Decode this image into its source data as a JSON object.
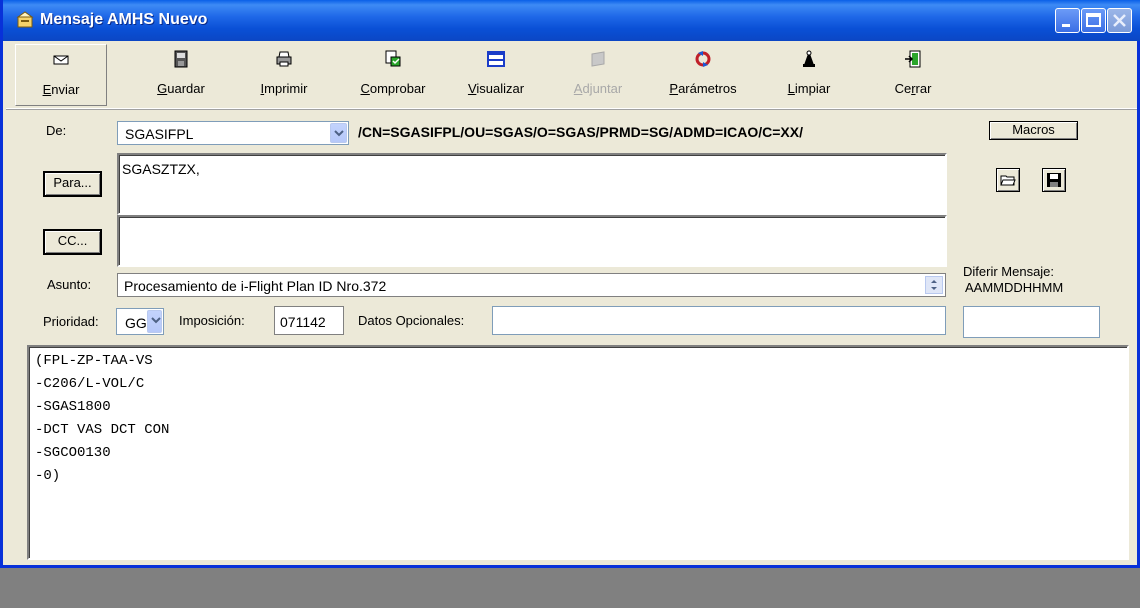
{
  "window": {
    "title": "Mensaje AMHS Nuevo"
  },
  "toolbar": {
    "items": [
      {
        "label": "Enviar",
        "accel": "E",
        "rest": "nviar",
        "icon": "send-icon",
        "enabled": true
      },
      {
        "label": "Guardar",
        "accel": "G",
        "rest": "uardar",
        "icon": "save-icon",
        "enabled": true
      },
      {
        "label": "Imprimir",
        "accel": "I",
        "rest": "mprimir",
        "icon": "print-icon",
        "enabled": true
      },
      {
        "label": "Comprobar",
        "accel": "C",
        "rest": "omprobar",
        "icon": "check-icon",
        "enabled": true
      },
      {
        "label": "Visualizar",
        "accel": "V",
        "rest": "isualizar",
        "icon": "view-icon",
        "enabled": true
      },
      {
        "label": "Adjuntar",
        "accel": "A",
        "rest": "djuntar",
        "icon": "attach-icon",
        "enabled": false
      },
      {
        "label": "Parámetros",
        "accel": "P",
        "rest": "arámetros",
        "icon": "parameters-icon",
        "enabled": true
      },
      {
        "label": "Limpiar",
        "accel": "L",
        "rest": "impiar",
        "icon": "clear-icon",
        "enabled": true
      },
      {
        "label": "Cerrar",
        "pre": "Ce",
        "accel": "r",
        "rest": "rar",
        "icon": "close-door-icon",
        "enabled": true
      }
    ]
  },
  "form": {
    "de_label": "De:",
    "de_value": "SGASIFPL",
    "de_dn": "/CN=SGASIFPL/OU=SGAS/O=SGAS/PRMD=SG/ADMD=ICAO/C=XX/",
    "macros_label": "Macros",
    "para_label": "Para...",
    "para_value": "SGASZTZX,",
    "cc_label": "CC...",
    "cc_value": "",
    "asunto_label": "Asunto:",
    "asunto_value": "Procesamiento de i-Flight Plan ID Nro.372",
    "diferir_label": "Diferir Mensaje:",
    "diferir_format": "AAMMDDHHMM",
    "diferir_value": "",
    "prioridad_label": "Prioridad:",
    "prioridad_value": "GG",
    "imposicion_label": "Imposición:",
    "imposicion_value": "071142",
    "opcionales_label": "Datos Opcionales:",
    "opcionales_value": ""
  },
  "body": {
    "lines": [
      "(FPL-ZP-TAA-VS",
      "-C206/L-VOL/C",
      "-SGAS1800",
      "-DCT VAS DCT CON",
      "-SGCO0130",
      "-0)"
    ]
  },
  "colors": {
    "titlebar": "#0a50d6",
    "window_bg": "#ece9d8",
    "desktop": "#808080"
  }
}
